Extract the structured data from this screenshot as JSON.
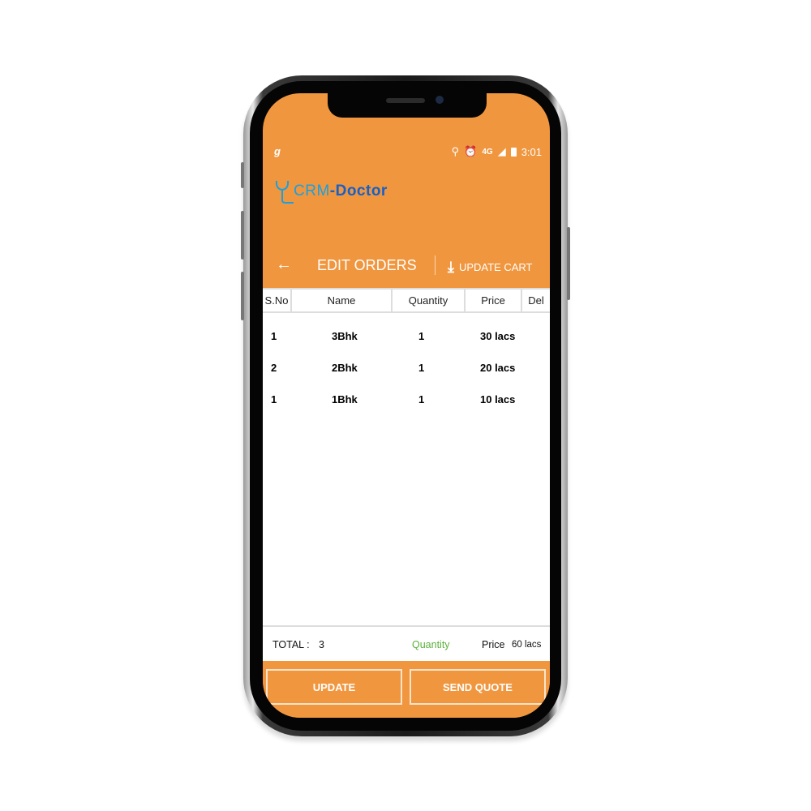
{
  "status_bar": {
    "left_icon": "g",
    "icons": [
      "location-icon",
      "alarm-icon",
      "4g-icon",
      "signal-icon",
      "battery-icon"
    ],
    "time": "3:01"
  },
  "logo": {
    "text_a": "CRM",
    "text_b": "-Doctor",
    "icon": "stethoscope-icon"
  },
  "toolbar": {
    "back_icon": "arrow-left-icon",
    "title": "EDIT ORDERS",
    "update_cart_label": "UPDATE CART",
    "update_cart_icon": "download-icon"
  },
  "table": {
    "columns": [
      "S.No",
      "Name",
      "Quantity",
      "Price",
      "Del"
    ],
    "rows": [
      {
        "sno": "1",
        "name": "3Bhk",
        "quantity": "1",
        "price": "30 lacs"
      },
      {
        "sno": "2",
        "name": "2Bhk",
        "quantity": "1",
        "price": "20 lacs"
      },
      {
        "sno": "1",
        "name": "1Bhk",
        "quantity": "1",
        "price": "10 lacs"
      }
    ]
  },
  "footer": {
    "total_label": "TOTAL :",
    "total_value": "3",
    "quantity_label": "Quantity",
    "price_label": "Price",
    "price_value": "60 lacs"
  },
  "actions": {
    "update_label": "UPDATE",
    "send_quote_label": "SEND QUOTE"
  },
  "colors": {
    "brand_orange": "#f0963e",
    "quantity_green": "#5cb03c",
    "logo_blue": "#1560c9"
  }
}
